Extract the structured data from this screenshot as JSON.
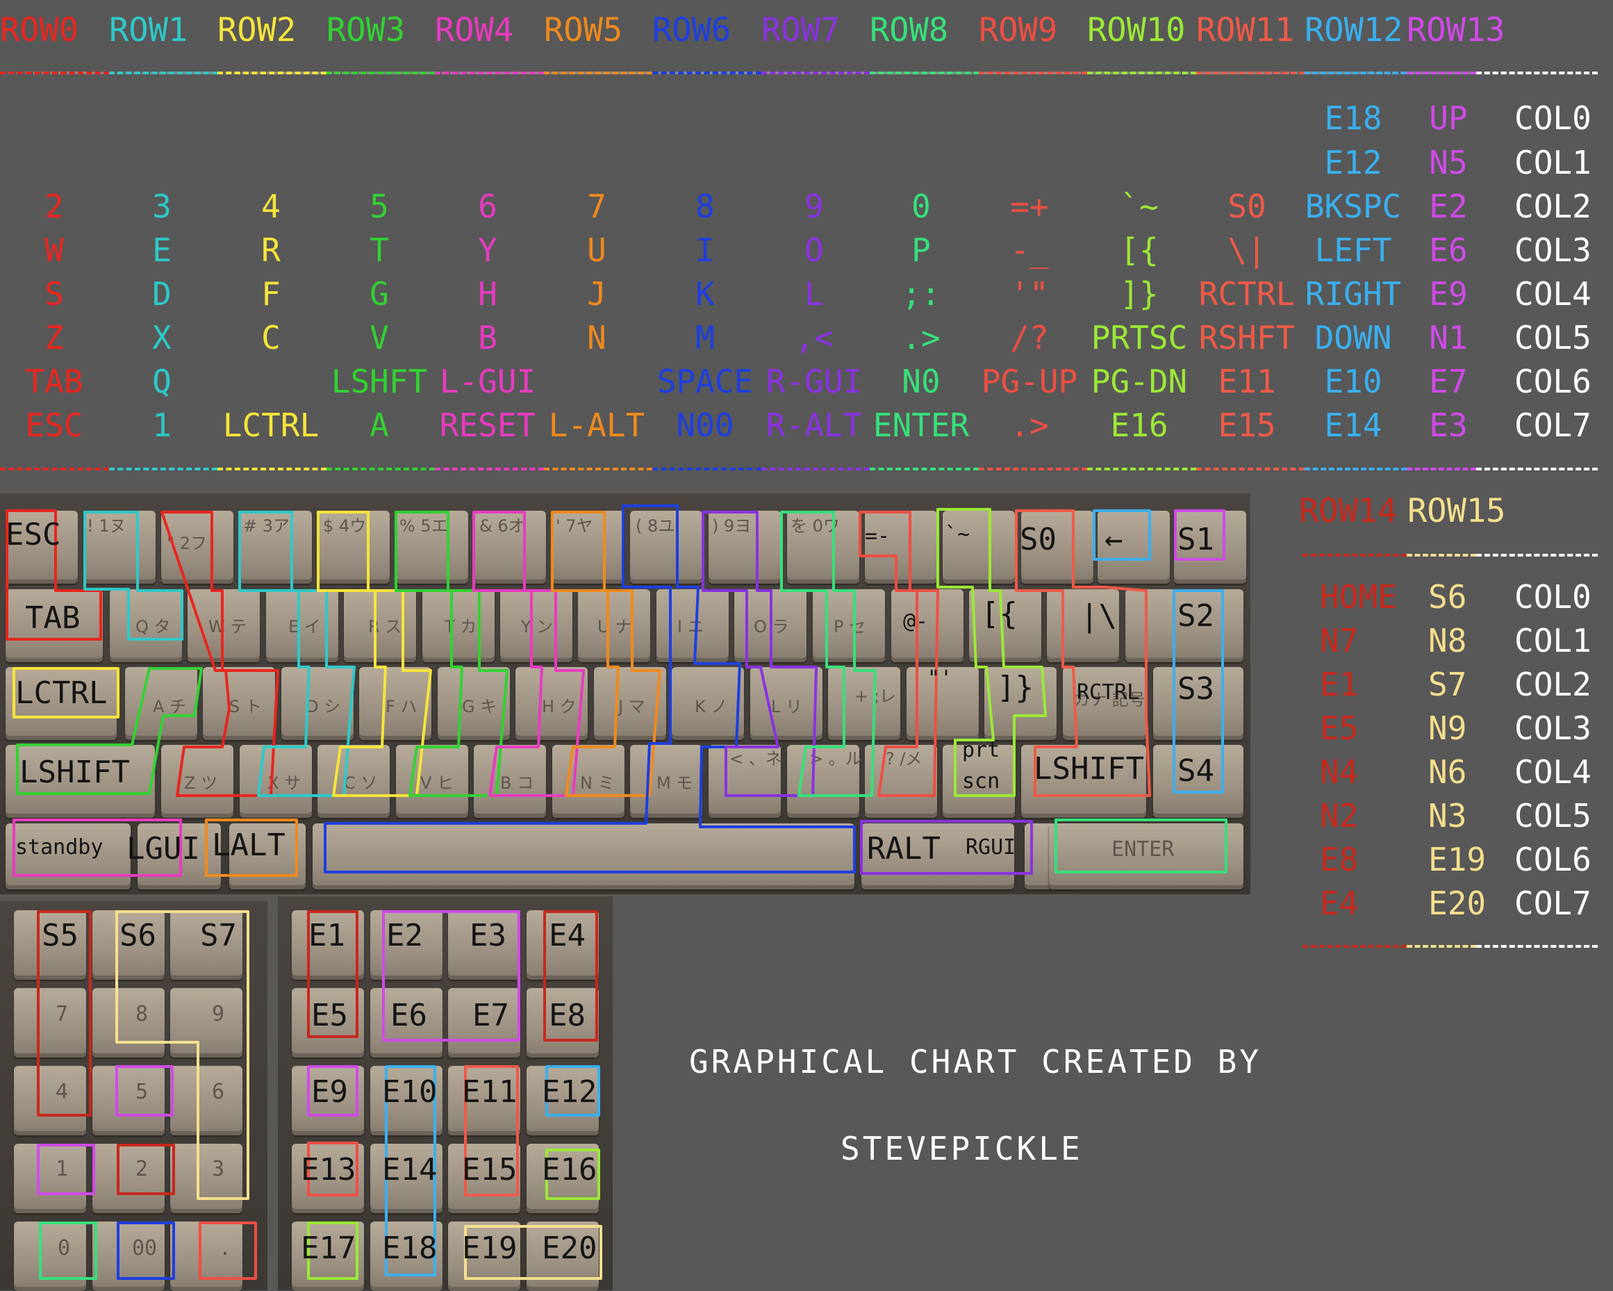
{
  "colors": {
    "background": "#585858",
    "row0": "#e8261f",
    "row1": "#2ec9c9",
    "row2": "#f7e43a",
    "row3": "#32d232",
    "row4": "#e83bc0",
    "row5": "#f08a1e",
    "row6": "#1e3fe0",
    "row7": "#8a32e0",
    "row8": "#36e07a",
    "row9": "#ee4f43",
    "row10": "#9be836",
    "row11": "#f05a48",
    "row12": "#3ab0f0",
    "row13": "#d04ae8",
    "row14": "#c8281c",
    "row15": "#f5df8e",
    "text": "#ffffff"
  },
  "matrix_top": {
    "rows": [
      "ROW0",
      "ROW1",
      "ROW2",
      "ROW3",
      "ROW4",
      "ROW5",
      "ROW6",
      "ROW7",
      "ROW8",
      "ROW9",
      "ROW10",
      "ROW11",
      "ROW12",
      "ROW13"
    ],
    "columns": [
      "COL0",
      "COL1",
      "COL2",
      "COL3",
      "COL4",
      "COL5",
      "COL6",
      "COL7"
    ],
    "cells": [
      [
        "",
        "",
        "",
        "",
        "",
        "",
        "",
        "",
        "",
        "",
        "",
        "",
        "E18",
        "UP"
      ],
      [
        "",
        "",
        "",
        "",
        "",
        "",
        "",
        "",
        "",
        "",
        "",
        "",
        "E12",
        "N5"
      ],
      [
        "2",
        "3",
        "4",
        "5",
        "6",
        "7",
        "8",
        "9",
        "0",
        "=+",
        "`~",
        "S0",
        "BKSPC",
        "E2"
      ],
      [
        "W",
        "E",
        "R",
        "T",
        "Y",
        "U",
        "I",
        "O",
        "P",
        "-_",
        "[{",
        "\\|",
        "LEFT",
        "E6"
      ],
      [
        "S",
        "D",
        "F",
        "G",
        "H",
        "J",
        "K",
        "L",
        ";:",
        "'\"",
        "]}",
        "RCTRL",
        "RIGHT",
        "E9"
      ],
      [
        "Z",
        "X",
        "C",
        "V",
        "B",
        "N",
        "M",
        ",<",
        ".>",
        "/?",
        "PRTSC",
        "RSHFT",
        "DOWN",
        "N1"
      ],
      [
        "TAB",
        "Q",
        "",
        "LSHFT",
        "L-GUI",
        "",
        "SPACE",
        "R-GUI",
        "N0",
        "PG-UP",
        "PG-DN",
        "E11",
        "E10",
        "E7"
      ],
      [
        "ESC",
        "1",
        "LCTRL",
        "A",
        "RESET",
        "L-ALT",
        "N00",
        "R-ALT",
        "ENTER",
        ".>",
        "E16",
        "E15",
        "E14",
        "E3"
      ]
    ]
  },
  "matrix_side": {
    "rows": [
      "ROW14",
      "ROW15"
    ],
    "columns": [
      "COL0",
      "COL1",
      "COL2",
      "COL3",
      "COL4",
      "COL5",
      "COL6",
      "COL7"
    ],
    "cells": [
      [
        "HOME",
        "S6"
      ],
      [
        "N7",
        "N8"
      ],
      [
        "E1",
        "S7"
      ],
      [
        "E5",
        "N9"
      ],
      [
        "N4",
        "N6"
      ],
      [
        "N2",
        "N3"
      ],
      [
        "E8",
        "E19"
      ],
      [
        "E4",
        "E20"
      ]
    ]
  },
  "keyboard": {
    "labels": {
      "esc": "ESC",
      "tab": "TAB",
      "lctrl": "LCTRL",
      "lshift": "LSHIFT",
      "standby": "standby",
      "lgui": "LGUI",
      "lalt": "LALT",
      "ralt": "RALT",
      "rgui": "RGUI",
      "eq": "=-",
      "tilde": "`~",
      "s0": "S0",
      "arrow": "←",
      "s1": "S1",
      "at": "@-",
      "lbrace": "[{",
      "pipe": "|\\",
      "s2": "S2",
      "rbrace": "]}",
      "rctrl": "RCTRL",
      "s3": "S3",
      "quote": "\"'",
      "prt": "prt",
      "scn": "scn",
      "rshift": "LSHIFT",
      "s4": "S4",
      "enter": "ENTER"
    },
    "legends": [
      "! 1ヌ",
      "\" 2フ",
      "# 3ア",
      "$ 4ウ",
      "% 5エ",
      "& 6オ",
      "' 7ヤ",
      "( 8ユ",
      ") 9ヨ",
      "を 0ワ",
      "Q タ",
      "W テ",
      "E イ",
      "R ス",
      "T カ",
      "Y ン",
      "U ナ",
      "I ニ",
      "O ラ",
      "P セ",
      "A チ",
      "S ト",
      "D シ",
      "F ハ",
      "G キ",
      "H ク",
      "J マ",
      "K ノ",
      "L リ",
      "+ ;レ",
      "Z ツ",
      "X サ",
      "C ソ",
      "V ヒ",
      "B コ",
      "N ミ",
      "M モ",
      "< 、ネ",
      "> 。ル",
      "? /メ",
      "カナ 記号"
    ]
  },
  "numpad": {
    "labels": {
      "s5": "S5",
      "s6": "S6",
      "s7": "S7",
      "k7": "7",
      "k8": "8",
      "k9": "9",
      "k4": "4",
      "k5": "5",
      "k6": "6",
      "k1": "1",
      "k2": "2",
      "k3": "3",
      "k0": "0",
      "k00": "00",
      "kdot": "."
    }
  },
  "epad": {
    "labels": {
      "e1": "E1",
      "e2": "E2",
      "e3": "E3",
      "e4": "E4",
      "e5": "E5",
      "e6": "E6",
      "e7": "E7",
      "e8": "E8",
      "e9": "E9",
      "e10": "E10",
      "e11": "E11",
      "e12": "E12",
      "e13": "E13",
      "e14": "E14",
      "e15": "E15",
      "e16": "E16",
      "e17": "E17",
      "e18": "E18",
      "e19": "E19",
      "e20": "E20"
    }
  },
  "credit": {
    "line1": "GRAPHICAL CHART CREATED BY",
    "line2": "STEVEPICKLE"
  }
}
